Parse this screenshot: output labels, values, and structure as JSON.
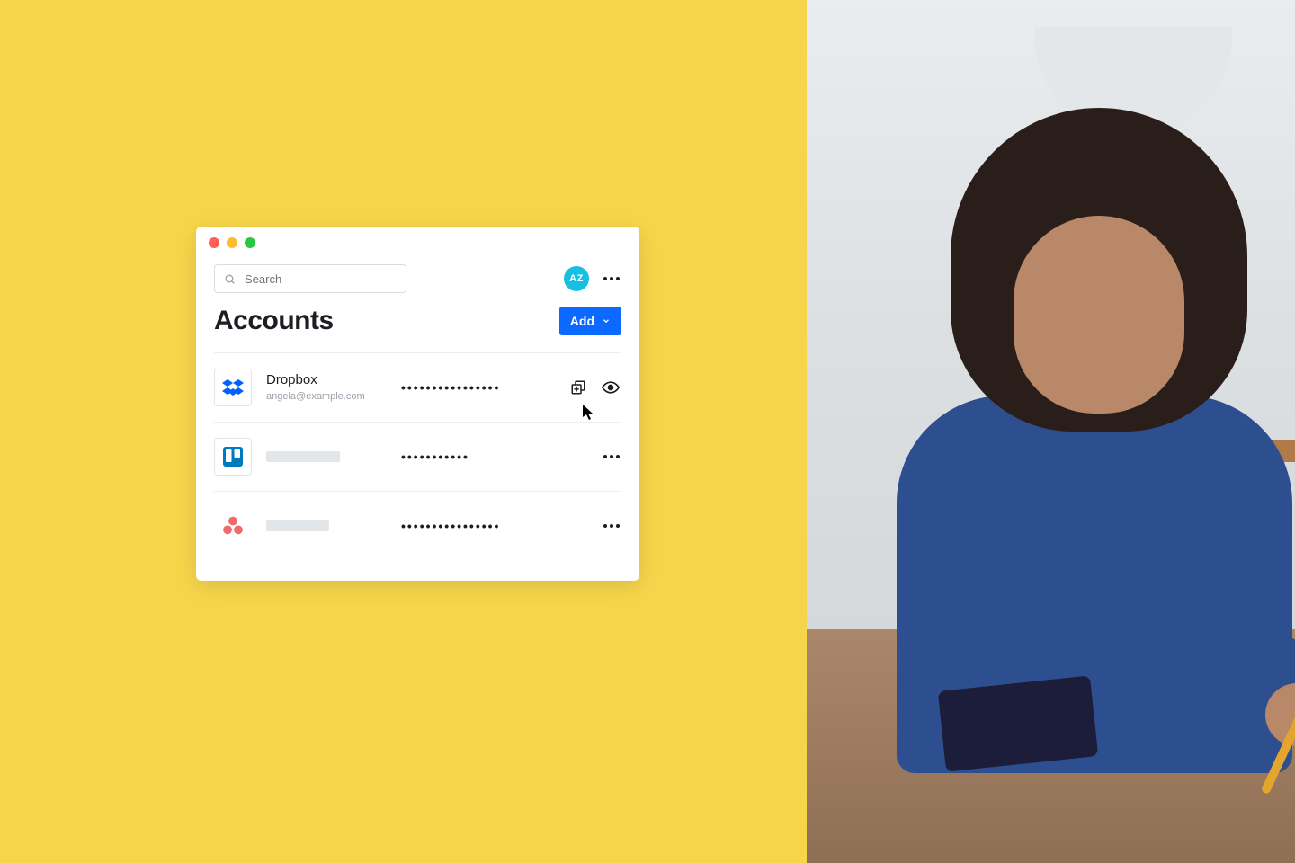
{
  "colors": {
    "accent": "#0b69ff",
    "avatar": "#17bfe3",
    "page_bg": "#f7d54b"
  },
  "window": {
    "search_placeholder": "Search",
    "avatar_initials": "AZ",
    "page_title": "Accounts",
    "add_button_label": "Add",
    "accounts": [
      {
        "icon": "dropbox-icon",
        "name": "Dropbox",
        "subtitle": "angela@example.com",
        "password_mask": "••••••••••••••••",
        "actions": [
          "copy",
          "reveal"
        ]
      },
      {
        "icon": "trello-icon",
        "name": "",
        "subtitle": "",
        "password_mask": "•••••••••••",
        "actions": [
          "more"
        ]
      },
      {
        "icon": "asana-icon",
        "name": "",
        "subtitle": "",
        "password_mask": "••••••••••••••••",
        "actions": [
          "more"
        ]
      }
    ]
  }
}
